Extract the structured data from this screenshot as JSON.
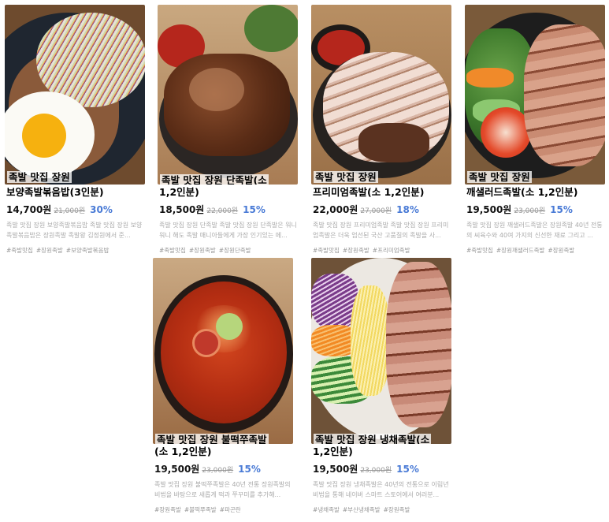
{
  "products": [
    {
      "store": "족발 맛집 장원",
      "name": "보양족발볶음밥(3인분)",
      "price": "14,700원",
      "original_price": "21,000원",
      "discount": "30%",
      "description": "족발 맛집 장원 보양족발볶음밥 족발 맛집 장원 보양족발볶음밥은 장원족발 족발왕 김정원에서 준...",
      "tags": [
        "#족발맛집",
        "#장원족발",
        "#보양족발볶음밥"
      ],
      "image_icon": "fried-rice-with-egg-image"
    },
    {
      "store": "족발 맛집 장원",
      "name": "단족발(소 1,2인분)",
      "name_line1": "족발 맛집 장원 단족발(소",
      "name_line2": "1,2인분)",
      "price": "18,500원",
      "original_price": "22,000원",
      "discount": "15%",
      "description": "족발 맛집 장원 단족발 족발 맛집 장원 단족발은 워니워니 해도 족발 매니아들에게 가장 인기있는 메...",
      "tags": [
        "#족발맛집",
        "#장원족발",
        "#장원단족발"
      ],
      "image_icon": "sweet-jokbal-image"
    },
    {
      "store": "족발 맛집 장원",
      "name": "프리미엄족발(소 1,2인분)",
      "name_line1": "족발 맛집 장원",
      "name_line2": "프리미엄족발(소 1,2인분)",
      "price": "22,000원",
      "original_price": "27,000원",
      "discount": "18%",
      "description": "족발 맛집 장원 프리미엄족발 족발 맛집 장원 프리미엄족발은 더욱 엄선된 국산 고품질의 족발을 사...",
      "tags": [
        "#족발맛집",
        "#장원족발",
        "#프리미엄족발"
      ],
      "image_icon": "premium-jokbal-image"
    },
    {
      "store": "족발 맛집 장원",
      "name": "깨샐러드족발(소 1,2인분)",
      "name_line1": "족발 맛집 장원",
      "name_line2": "깨샐러드족발(소 1,2인분)",
      "price": "19,500원",
      "original_price": "23,000원",
      "discount": "15%",
      "description": "족발 맛집 장원 깨샐러드족발은 장원족발 40년 전통의 씨육수와 40여 가지의 신선한 재료 그리고 ...",
      "tags": [
        "#족발맛집",
        "#장원깨샐러드족발",
        "#장원족발"
      ],
      "image_icon": "salad-jokbal-image"
    },
    {
      "store": "족발 맛집 장원",
      "name": "불떡쭈족발(소 1,2인분)",
      "name_line1": "족발 맛집 장원 불떡쭈족발",
      "name_line2": "(소 1,2인분)",
      "price": "19,500원",
      "original_price": "23,000원",
      "discount": "15%",
      "description": "족발 맛집 장원 불떡쭈족발은 40년 전통 장원족발의 비법을 바탕으로 새롭게 떡과 쭈꾸미를 추가해...",
      "tags": [
        "#장원족발",
        "#불떡쭈족발",
        "#파곤란"
      ],
      "image_icon": "spicy-jokbal-image"
    },
    {
      "store": "족발 맛집 장원",
      "name": "냉채족발(소 1,2인분)",
      "name_line1": "족발 맛집 장원 냉채족발(소",
      "name_line2": "1,2인분)",
      "price": "19,500원",
      "original_price": "23,000원",
      "discount": "15%",
      "description": "족발 맛집 장원 냉채족발은 40년의 전통으로 이림년 비법을 통해 네이버 스마트 스토어에서 여러분...",
      "tags": [
        "#냉채족발",
        "#부산냉채족발",
        "#장원족발"
      ],
      "image_icon": "cold-jokbal-image"
    }
  ]
}
